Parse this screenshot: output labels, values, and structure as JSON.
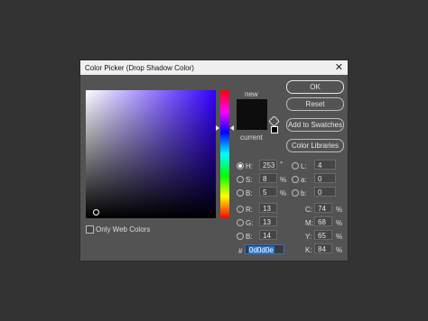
{
  "dialog": {
    "title": "Color Picker (Drop Shadow Color)",
    "close_symbol": "✕"
  },
  "swatch": {
    "new_label": "new",
    "current_label": "current",
    "color": "#0d0d0e"
  },
  "buttons": {
    "ok": "OK",
    "reset": "Reset",
    "add_to_swatches": "Add to Swatches",
    "color_libraries": "Color Libraries"
  },
  "only_web_colors": "Only Web Colors",
  "hsb": {
    "h_label": "H:",
    "h_value": "253",
    "h_unit": "°",
    "s_label": "S:",
    "s_value": "8",
    "s_unit": "%",
    "b_label": "B:",
    "b_value": "5",
    "b_unit": "%"
  },
  "rgb": {
    "r_label": "R:",
    "r_value": "13",
    "g_label": "G:",
    "g_value": "13",
    "b_label": "B:",
    "b_value": "14"
  },
  "lab": {
    "l_label": "L:",
    "l_value": "4",
    "a_label": "a:",
    "a_value": "0",
    "b_label": "b:",
    "b_value": "0"
  },
  "cmyk": {
    "c_label": "C:",
    "c_value": "74",
    "c_unit": "%",
    "m_label": "M:",
    "m_value": "68",
    "m_unit": "%",
    "y_label": "Y:",
    "y_value": "65",
    "y_unit": "%",
    "k_label": "K:",
    "k_value": "84",
    "k_unit": "%"
  },
  "hex": {
    "label": "#",
    "value": "0d0d0e"
  },
  "icons": [
    "out-of-gamut-icon",
    "web-safe-cube-icon",
    "hue-slider-arrow-icon"
  ]
}
